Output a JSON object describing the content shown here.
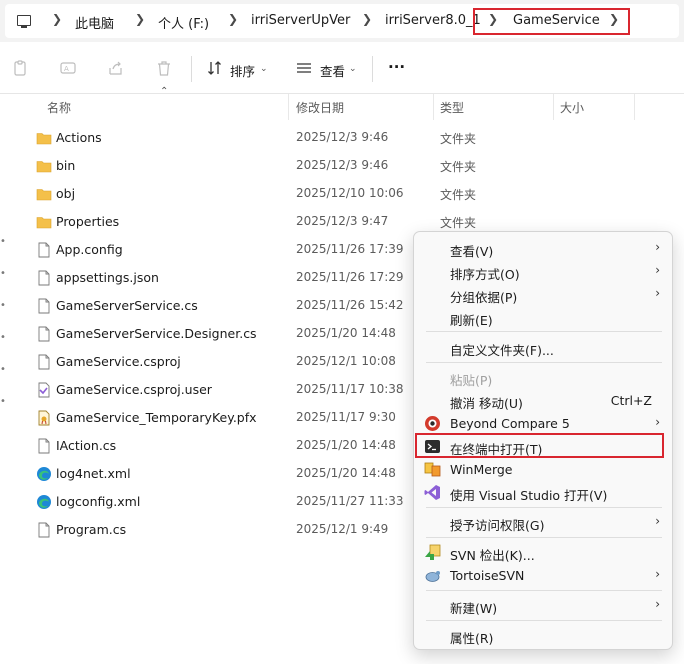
{
  "breadcrumb": {
    "items": [
      "此电脑",
      "个人 (F:)",
      "irriServerUpVer",
      "irriServer8.0_1",
      "GameService"
    ]
  },
  "toolbar": {
    "sort_label": "排序",
    "view_label": "查看",
    "more_label": "···"
  },
  "columns": {
    "name": "名称",
    "modified": "修改日期",
    "type": "类型",
    "size": "大小"
  },
  "files": [
    {
      "name": "Actions",
      "date": "2025/12/3 9:46",
      "type": "文件夹",
      "icon": "folder-icon"
    },
    {
      "name": "bin",
      "date": "2025/12/3 9:46",
      "type": "文件夹",
      "icon": "folder-icon"
    },
    {
      "name": "obj",
      "date": "2025/12/10 10:06",
      "type": "文件夹",
      "icon": "folder-icon"
    },
    {
      "name": "Properties",
      "date": "2025/12/3 9:47",
      "type": "文件夹",
      "icon": "folder-icon"
    },
    {
      "name": "App.config",
      "date": "2025/11/26 17:39",
      "type": "",
      "icon": "file-icon"
    },
    {
      "name": "appsettings.json",
      "date": "2025/11/26 17:29",
      "type": "",
      "icon": "file-icon"
    },
    {
      "name": "GameServerService.cs",
      "date": "2025/11/26 15:42",
      "type": "",
      "icon": "file-icon"
    },
    {
      "name": "GameServerService.Designer.cs",
      "date": "2025/1/20 14:48",
      "type": "",
      "icon": "file-icon"
    },
    {
      "name": "GameService.csproj",
      "date": "2025/12/1 10:08",
      "type": "",
      "icon": "file-icon"
    },
    {
      "name": "GameService.csproj.user",
      "date": "2025/11/17 10:38",
      "type": "",
      "icon": "vs-file-icon"
    },
    {
      "name": "GameService_TemporaryKey.pfx",
      "date": "2025/11/17 9:30",
      "type": "",
      "icon": "certificate-icon"
    },
    {
      "name": "IAction.cs",
      "date": "2025/1/20 14:48",
      "type": "",
      "icon": "file-icon"
    },
    {
      "name": "log4net.xml",
      "date": "2025/1/20 14:48",
      "type": "",
      "icon": "edge-icon"
    },
    {
      "name": "logconfig.xml",
      "date": "2025/11/27 11:33",
      "type": "",
      "icon": "edge-icon"
    },
    {
      "name": "Program.cs",
      "date": "2025/12/1 9:49",
      "type": "",
      "icon": "file-icon"
    }
  ],
  "context_menu": {
    "view": "查看(V)",
    "sort": "排序方式(O)",
    "group": "分组依据(P)",
    "refresh": "刷新(E)",
    "customize": "自定义文件夹(F)...",
    "paste": "粘贴(P)",
    "undo": "撤消 移动(U)",
    "undo_shortcut": "Ctrl+Z",
    "beyond_compare": "Beyond Compare 5",
    "terminal": "在终端中打开(T)",
    "winmerge": "WinMerge",
    "visual_studio": "使用 Visual Studio 打开(V)",
    "grant_access": "授予访问权限(G)",
    "svn_checkout": "SVN 检出(K)...",
    "tortoise": "TortoiseSVN",
    "new": "新建(W)",
    "properties": "属性(R)"
  },
  "colors": {
    "highlight": "#d9262f",
    "folder": "#f4c04a"
  }
}
